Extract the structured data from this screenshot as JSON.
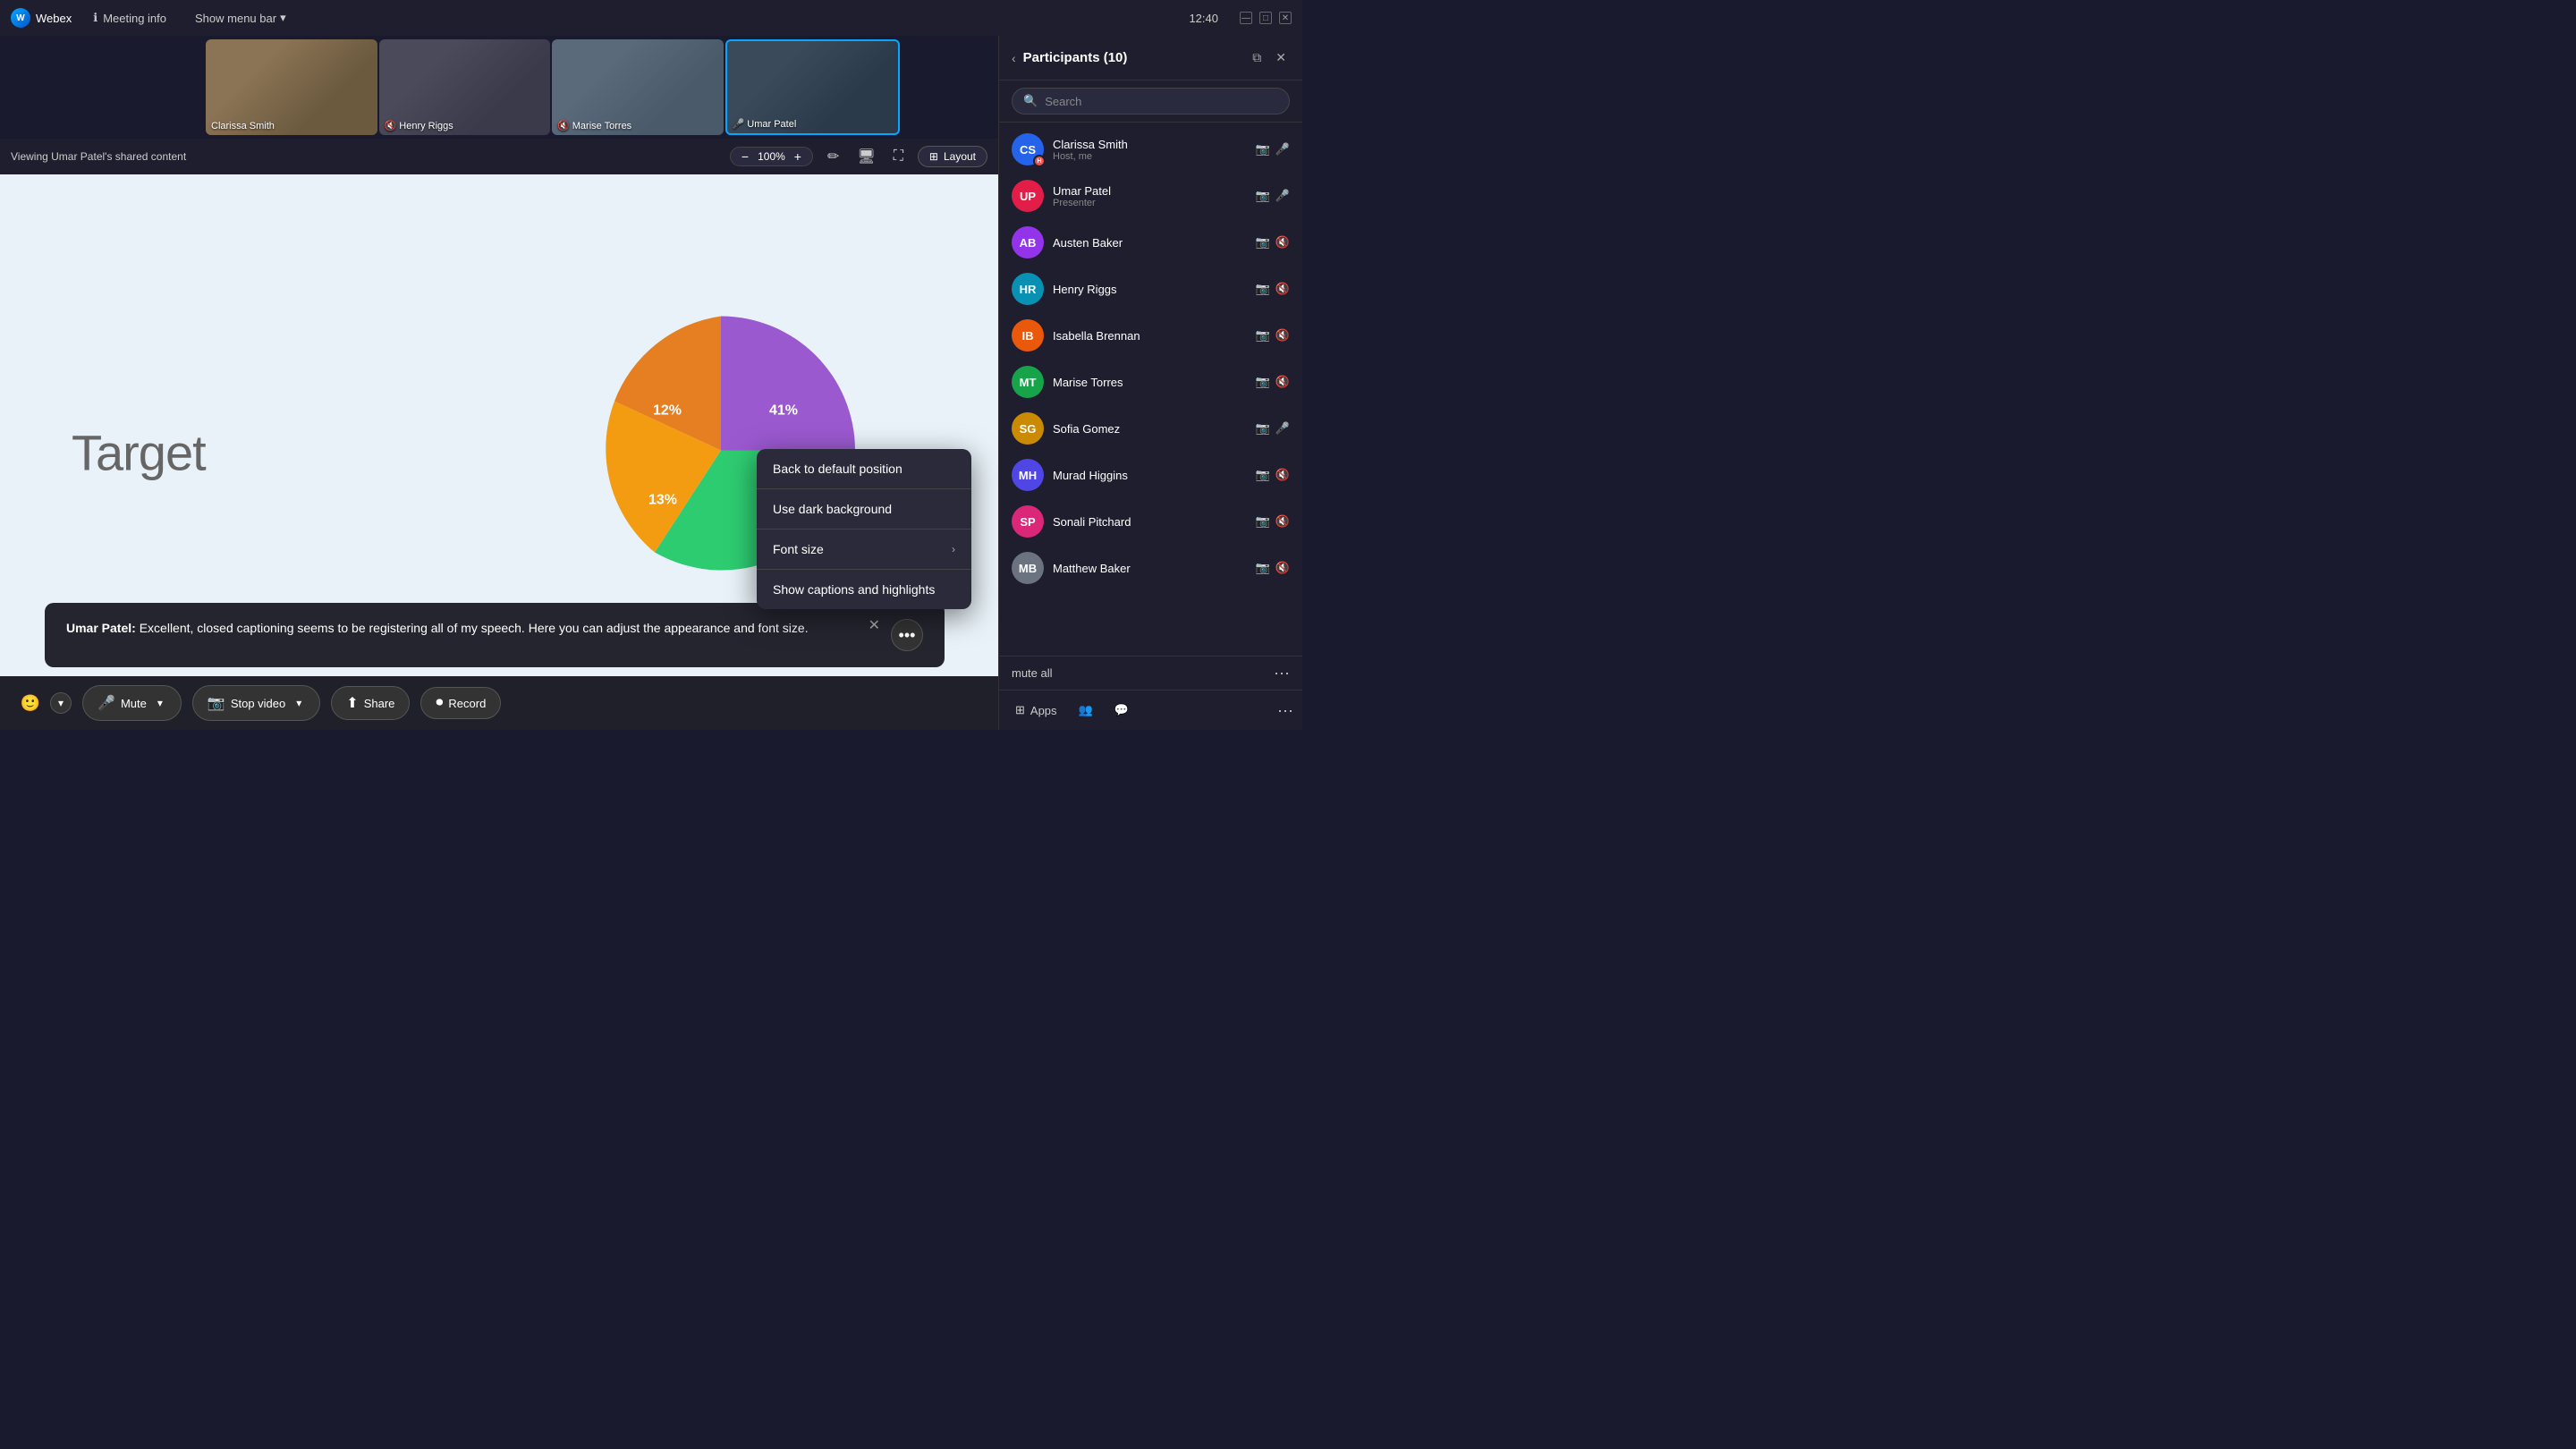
{
  "titlebar": {
    "app_name": "Webex",
    "meeting_info_label": "Meeting info",
    "show_menu_label": "Show menu bar",
    "time": "12:40"
  },
  "thumbnail_strip": {
    "participants": [
      {
        "name": "Clarissa Smith",
        "bg": "thumb-bg-1"
      },
      {
        "name": "Henry Riggs",
        "bg": "thumb-bg-2"
      },
      {
        "name": "Marise Torres",
        "bg": "thumb-bg-3"
      },
      {
        "name": "Umar Patel",
        "bg": "thumb-bg-4",
        "active": true
      }
    ]
  },
  "sharing": {
    "label": "Viewing Umar Patel's shared content",
    "zoom": "100%",
    "layout_label": "Layout"
  },
  "slide": {
    "title": "Target",
    "chart": {
      "segments": [
        {
          "value": 41,
          "label": "41%",
          "color": "#9b59d0"
        },
        {
          "value": 34,
          "label": "34%",
          "color": "#2ecc71"
        },
        {
          "value": 13,
          "label": "13%",
          "color": "#f39c12"
        },
        {
          "value": 12,
          "label": "12%",
          "color": "#e67e22"
        }
      ]
    }
  },
  "caption": {
    "speaker": "Umar Patel",
    "text": "Excellent, closed captioning seems to be registering all of my speech. Here you can adjust the appearance and font size."
  },
  "caption_menu": {
    "items": [
      {
        "label": "Back to default position",
        "has_arrow": false
      },
      {
        "label": "Use dark background",
        "has_arrow": false
      },
      {
        "label": "Font size",
        "has_arrow": true
      },
      {
        "label": "Show captions and highlights",
        "has_arrow": false
      }
    ]
  },
  "bottom_controls": {
    "mute_label": "Mute",
    "stop_video_label": "Stop video",
    "share_label": "Share",
    "record_label": "Record"
  },
  "participants_panel": {
    "title": "Participants",
    "count": 10,
    "search_placeholder": "Search",
    "mute_all_label": "mute all",
    "participants": [
      {
        "name": "Clarissa Smith",
        "role": "Host, me",
        "initials": "CS",
        "av_class": "av-blue",
        "cam": true,
        "mic": true,
        "muted": false
      },
      {
        "name": "Umar Patel",
        "role": "Presenter",
        "initials": "UP",
        "av_class": "av-rose",
        "cam": true,
        "mic": true,
        "muted": false
      },
      {
        "name": "Austen Baker",
        "role": "",
        "initials": "AB",
        "av_class": "av-purple",
        "cam": true,
        "mic": false,
        "muted": true
      },
      {
        "name": "Henry Riggs",
        "role": "",
        "initials": "HR",
        "av_class": "av-teal",
        "cam": true,
        "mic": false,
        "muted": true
      },
      {
        "name": "Isabella Brennan",
        "role": "",
        "initials": "IB",
        "av_class": "av-orange",
        "cam": true,
        "mic": false,
        "muted": true
      },
      {
        "name": "Marise Torres",
        "role": "",
        "initials": "MT",
        "av_class": "av-green",
        "cam": true,
        "mic": false,
        "muted": true
      },
      {
        "name": "Sofia Gomez",
        "role": "",
        "initials": "SG",
        "av_class": "av-yellow",
        "cam": true,
        "mic": true,
        "muted": false
      },
      {
        "name": "Murad Higgins",
        "role": "",
        "initials": "MH",
        "av_class": "av-indigo",
        "cam": true,
        "mic": false,
        "muted": true
      },
      {
        "name": "Sonali Pitchard",
        "role": "",
        "initials": "SP",
        "av_class": "av-pink",
        "cam": true,
        "mic": false,
        "muted": true
      },
      {
        "name": "Matthew Baker",
        "role": "",
        "initials": "MB",
        "av_class": "av-gray",
        "cam": true,
        "mic": false,
        "muted": true
      }
    ],
    "footer": {
      "mute_all": "mute all",
      "apps_label": "Apps"
    }
  }
}
